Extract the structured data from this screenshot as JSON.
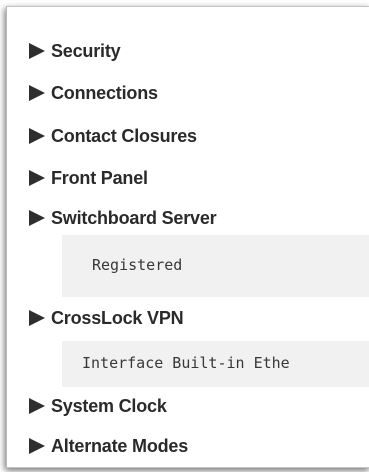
{
  "tree": {
    "items": [
      {
        "label": "Security"
      },
      {
        "label": "Connections"
      },
      {
        "label": "Contact Closures"
      },
      {
        "label": "Front Panel"
      },
      {
        "label": "Switchboard Server"
      },
      {
        "label": "CrossLock VPN"
      },
      {
        "label": "System Clock"
      },
      {
        "label": "Alternate Modes"
      }
    ],
    "switchboard_status": "Registered",
    "crosslock_interface": "Interface Built-in Ethe"
  },
  "icons": {
    "expander": "triangle-right-icon"
  }
}
